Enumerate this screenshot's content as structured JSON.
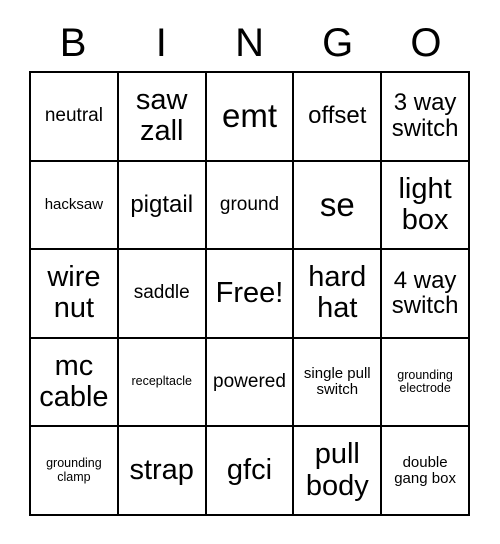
{
  "card": {
    "title": "BINGO",
    "header_letters": [
      "B",
      "I",
      "N",
      "G",
      "O"
    ],
    "grid_size": "5x5",
    "free_space_label": "Free!",
    "colors": {
      "background": "#ffffff",
      "border": "#000000",
      "text": "#000000"
    },
    "rows": [
      [
        {
          "label": "neutral",
          "size": "sm"
        },
        {
          "label": "saw zall",
          "size": "lg"
        },
        {
          "label": "emt",
          "size": "xl"
        },
        {
          "label": "offset",
          "size": "md"
        },
        {
          "label": "3 way switch",
          "size": "md"
        }
      ],
      [
        {
          "label": "hacksaw",
          "size": "xs"
        },
        {
          "label": "pigtail",
          "size": "md"
        },
        {
          "label": "ground",
          "size": "sm"
        },
        {
          "label": "se",
          "size": "xl"
        },
        {
          "label": "light box",
          "size": "lg"
        }
      ],
      [
        {
          "label": "wire nut",
          "size": "lg"
        },
        {
          "label": "saddle",
          "size": "sm"
        },
        {
          "label": "Free!",
          "size": "lg"
        },
        {
          "label": "hard hat",
          "size": "lg"
        },
        {
          "label": "4 way switch",
          "size": "md"
        }
      ],
      [
        {
          "label": "mc cable",
          "size": "lg"
        },
        {
          "label": "recepltacle",
          "size": "xxs"
        },
        {
          "label": "powered",
          "size": "sm"
        },
        {
          "label": "single pull switch",
          "size": "xs"
        },
        {
          "label": "grounding electrode",
          "size": "xxs"
        }
      ],
      [
        {
          "label": "grounding clamp",
          "size": "xxs"
        },
        {
          "label": "strap",
          "size": "lg"
        },
        {
          "label": "gfci",
          "size": "lg"
        },
        {
          "label": "pull body",
          "size": "lg"
        },
        {
          "label": "double gang box",
          "size": "xs"
        }
      ]
    ]
  }
}
